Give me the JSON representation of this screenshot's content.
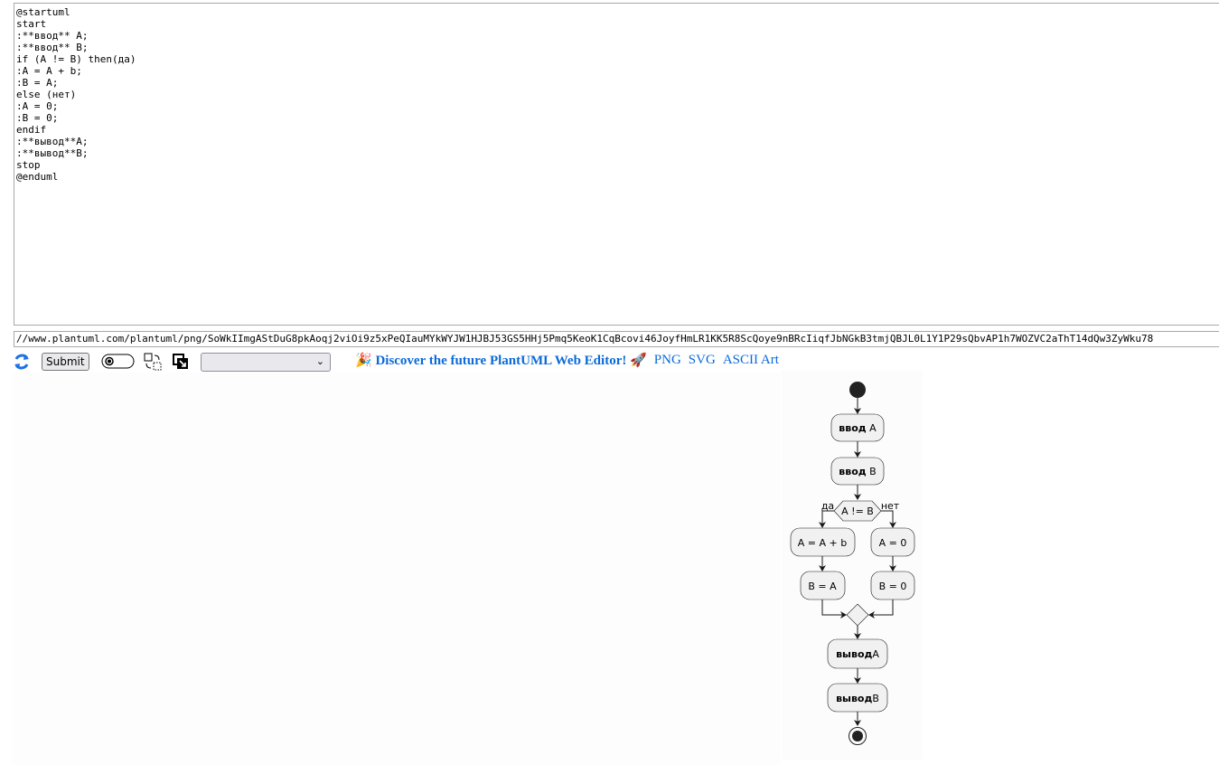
{
  "editor": {
    "source": "@startuml\nstart\n:**ввод** A;\n:**ввод** B;\nif (A != B) then(да)\n:A = A + b;\n:B = A;\nelse (нет)\n:A = 0;\n:B = 0;\nendif\n:**вывод**A;\n:**вывод**B;\nstop\n@enduml"
  },
  "url_field": {
    "value": "//www.plantuml.com/plantuml/png/SoWkIImgAStDuG8pkAoqj2viOi9z5xPeQIauMYkWYJW1HJBJ53GS5HHj5Pmq5KeoK1CqBcovi46JoyfHmLR1KK5R8ScQoye9nBRcIiqfJbNGkB3tmjQBJL0L1Y1P29sQbvAP1h7WOZVC2aThT14dQw3ZyWku78"
  },
  "toolbar": {
    "submit_label": "Submit",
    "select_value": "",
    "promo_emoji": "🎉",
    "promo_label": "Discover the future PlantUML Web Editor!",
    "rocket_emoji": "🚀",
    "formats": [
      "PNG",
      "SVG",
      "ASCII Art"
    ],
    "accent": "#0a6ad8"
  },
  "diagram": {
    "nodes": {
      "input_a": {
        "bold": "ввод",
        "rest": " A"
      },
      "input_b": {
        "bold": "ввод",
        "rest": " B"
      },
      "condition": "A != B",
      "yes_label": "да",
      "no_label": "нет",
      "yes_1": "A = A + b",
      "yes_2": "B = A",
      "no_1": "A = 0",
      "no_2": "B = 0",
      "output_a": {
        "bold": "вывод",
        "rest": "A"
      },
      "output_b": {
        "bold": "вывод",
        "rest": "B"
      }
    }
  }
}
